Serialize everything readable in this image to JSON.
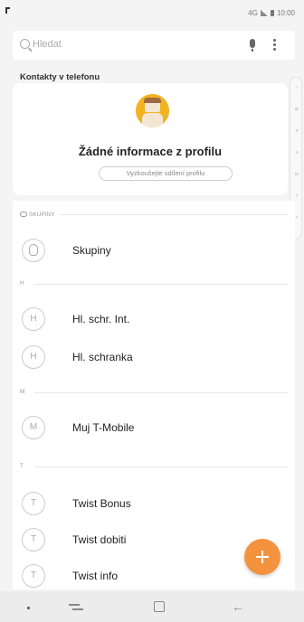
{
  "status_bar": {
    "time": "10:00",
    "network": "4G"
  },
  "search": {
    "placeholder": "Hledat"
  },
  "section_label": "Kontakty v telefonu",
  "alpha_index": [
    "☆",
    "Ø",
    "#",
    "A",
    "M",
    "T",
    "?"
  ],
  "profile": {
    "title": "Žádné informace z profilu",
    "share_button": "Vyzkoušejte sdílení profilu"
  },
  "groups_header": "SKUPINY",
  "groups_row": {
    "label": "Skupiny"
  },
  "sections": [
    {
      "letter": "H",
      "contacts": [
        {
          "initial": "H",
          "name": "Hl. schr. Int."
        },
        {
          "initial": "H",
          "name": "Hl. schranka"
        }
      ]
    },
    {
      "letter": "M",
      "contacts": [
        {
          "initial": "M",
          "name": "Muj T-Mobile"
        }
      ]
    },
    {
      "letter": "T",
      "contacts": [
        {
          "initial": "T",
          "name": "Twist Bonus"
        },
        {
          "initial": "T",
          "name": "Twist dobiti"
        },
        {
          "initial": "T",
          "name": "Twist info"
        }
      ]
    }
  ],
  "colors": {
    "accent": "#f4933d",
    "avatar": "#f2b320"
  }
}
